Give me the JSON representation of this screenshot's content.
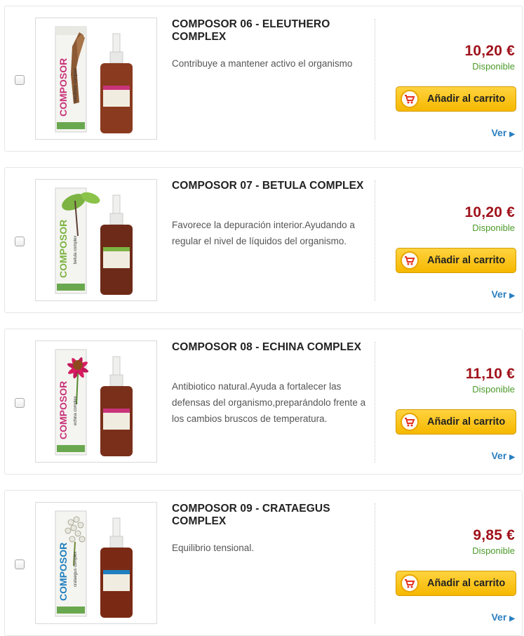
{
  "products": [
    {
      "title": "COMPOSOR 06 - ELEUTHERO COMPLEX",
      "description": "Contribuye a mantener activo el organismo",
      "price": "10,20 €",
      "availability": "Disponible",
      "cart_label": "Añadir al carrito",
      "view_label": "Ver",
      "image": {
        "herb": "eleuthero root",
        "box_accent": "#c9337a",
        "box_label": "COMPOSOR",
        "brand": "Soria Natural"
      }
    },
    {
      "title": "COMPOSOR 07 - BETULA COMPLEX",
      "description": "Favorece la depuración interior.Ayudando a regular el nivel de líquidos del organismo.",
      "price": "10,20 €",
      "availability": "Disponible",
      "cart_label": "Añadir al carrito",
      "view_label": "Ver",
      "image": {
        "herb": "birch leaves",
        "box_accent": "#7cb342",
        "box_label": "COMPOSOR",
        "brand": "Soria Natural"
      }
    },
    {
      "title": "COMPOSOR 08 - ECHINA COMPLEX",
      "description": "Antibiotico natural.Ayuda a fortalecer las defensas del organismo,preparándolo frente a los cambios bruscos de temperatura.",
      "price": "11,10 €",
      "availability": "Disponible",
      "cart_label": "Añadir al carrito",
      "view_label": "Ver",
      "image": {
        "herb": "echinacea flower",
        "box_accent": "#c9337a",
        "box_label": "COMPOSOR",
        "brand": "Soria Natural"
      }
    },
    {
      "title": "COMPOSOR 09 - CRATAEGUS COMPLEX",
      "description": "Equilibrio tensional.",
      "price": "9,85 €",
      "availability": "Disponible",
      "cart_label": "Añadir al carrito",
      "view_label": "Ver",
      "image": {
        "herb": "hawthorn flowers",
        "box_accent": "#1f7fbf",
        "box_label": "COMPOSOR",
        "brand": "Soria Natural"
      }
    }
  ],
  "colors": {
    "price": "#a0121b",
    "availability": "#4b9a2a",
    "link": "#2a7fc0",
    "button": "#f6b800"
  },
  "icons": {
    "cart": "shopping-cart-icon",
    "view_arrow": "triangle-right-icon"
  }
}
